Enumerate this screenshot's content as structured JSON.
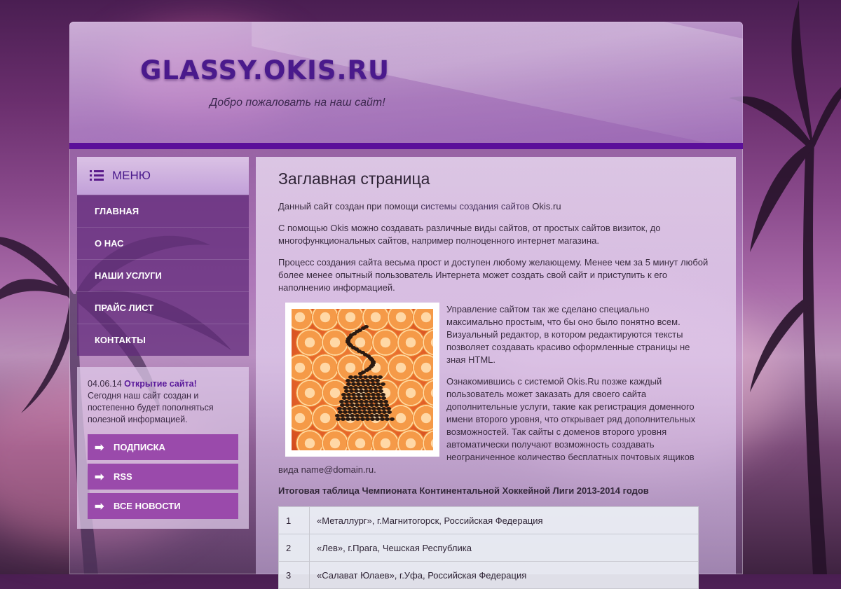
{
  "header": {
    "logo": "GLASSY.OKIS.RU",
    "slogan": "Добро пожаловать на наш сайт!"
  },
  "menu": {
    "title": "Меню",
    "items": [
      {
        "label": "Главная"
      },
      {
        "label": "О нас"
      },
      {
        "label": "Наши услуги"
      },
      {
        "label": "Прайс лист"
      },
      {
        "label": "Контакты"
      }
    ]
  },
  "news": {
    "date": "04.06.14",
    "headline": "Открытие сайта!",
    "text": "Сегодня наш сайт создан и постепенно будет пополняться полезной информацией.",
    "buttons": [
      {
        "label": "Подписка"
      },
      {
        "label": "RSS"
      },
      {
        "label": "Все новости"
      }
    ]
  },
  "content": {
    "title": "Заглавная страница",
    "p1_before": "Данный сайт создан при помощи ",
    "p1_link": "системы создания сайтов",
    "p1_after": " Okis.ru",
    "p2": "С помощью Okis можно создавать различные виды сайтов, от простых сайтов визиток, до многофункциональных сайтов, например полноценного интернет магазина.",
    "p3": "Процесс создания сайта весьма прост и доступен любому желающему. Менее чем за 5 минут любой более менее опытный пользователь Интернета может создать свой сайт и приступить к его наполнению информацией.",
    "p4": "Управление сайтом так же сделано специально максимально простым, что бы оно было понятно всем. Визуальный редактор, в котором редактируются тексты позволяет создавать красиво оформленные страницы не зная HTML.",
    "p5": "Ознакомившись с системой Okis.Ru позже каждый пользователь может заказать для своего сайта дополнительные услуги, такие как регистрация доменного имени второго уровня, что открывает ряд дополнительных возможностей. Так сайты с доменов второго уровня автоматически получают возможность создавать неограниченное количество бесплатных почтовых ящиков",
    "p5_end": "вида name@domain.ru.",
    "table_title": "Итоговая таблица Чемпионата Континентальной Хоккейной Лиги 2013-2014 годов",
    "table_rows": [
      {
        "num": "1",
        "team": "«Металлург», г.Магнитогорск, Российская Федерация"
      },
      {
        "num": "2",
        "team": " «Лев», г.Прага, Чешская Республика"
      },
      {
        "num": "3",
        "team": " «Салават Юлаев», г.Уфа, Российская Федерация"
      }
    ]
  }
}
